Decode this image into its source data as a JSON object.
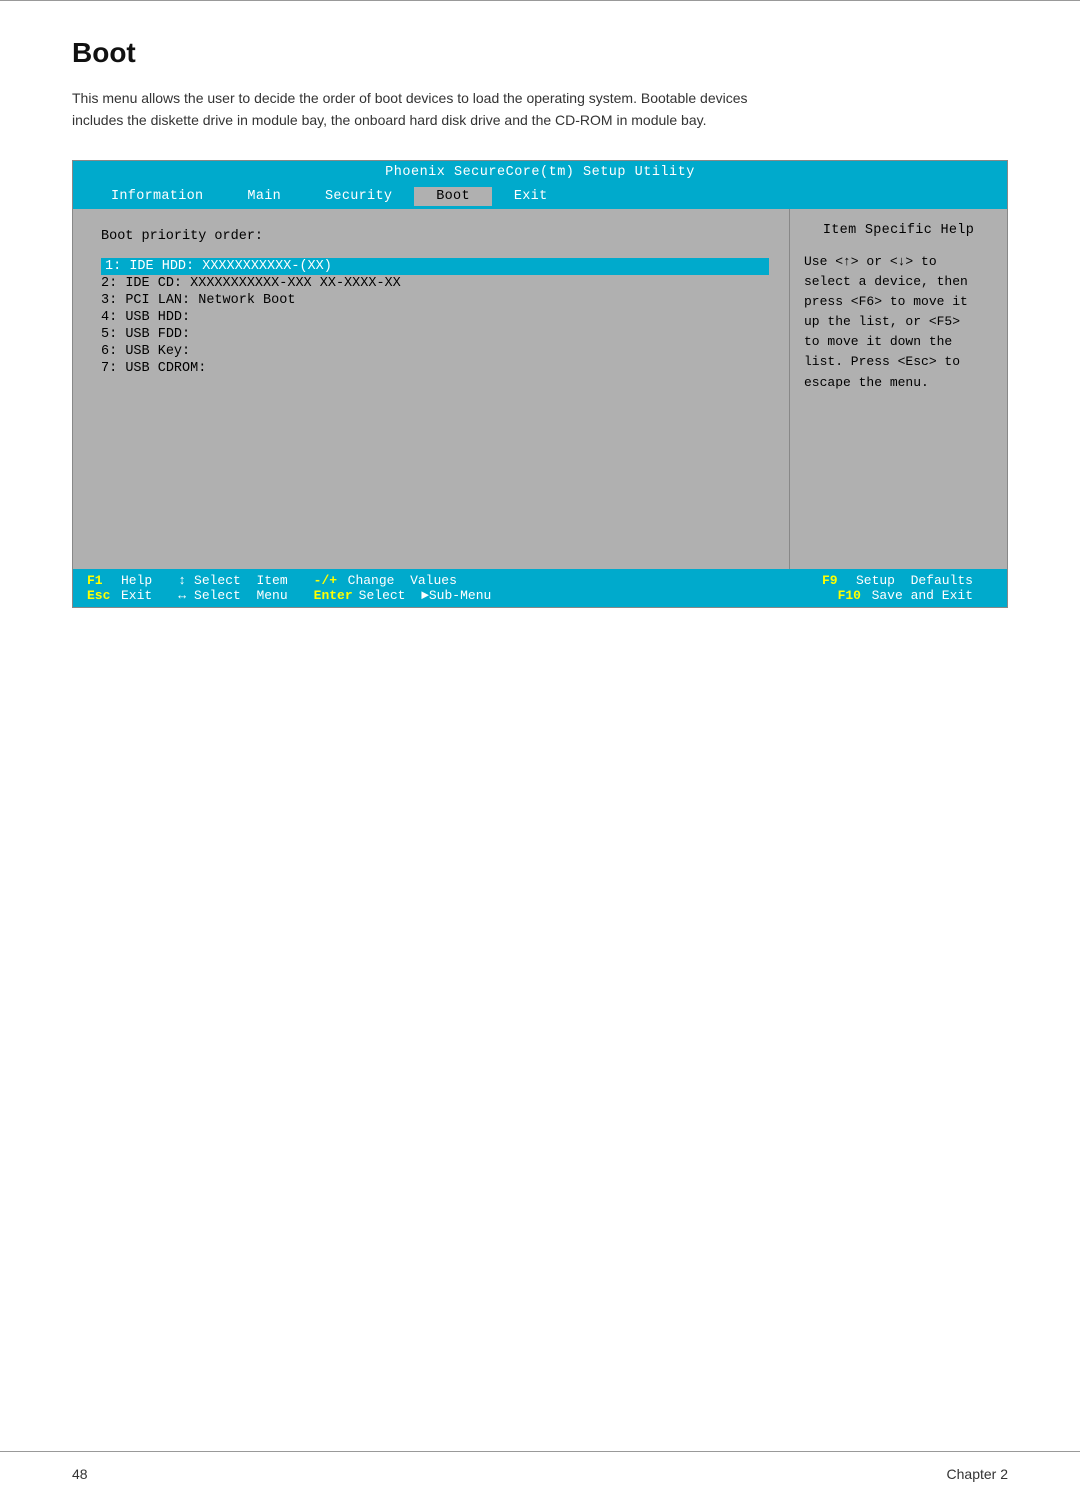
{
  "top_rule": true,
  "page": {
    "title": "Boot",
    "description_line1": "This menu allows the user to decide the order of boot devices to load the operating system. Bootable devices",
    "description_line2": "includes the diskette drive in module bay, the onboard hard disk drive and the CD-ROM in module bay."
  },
  "bios": {
    "title": "Phoenix SecureCore(tm) Setup Utility",
    "nav_items": [
      {
        "label": "Information",
        "active": false
      },
      {
        "label": "Main",
        "active": false
      },
      {
        "label": "Security",
        "active": false
      },
      {
        "label": "Boot",
        "active": true
      },
      {
        "label": "Exit",
        "active": false
      }
    ],
    "left_panel": {
      "section_title": "Boot priority order:",
      "boot_items": [
        {
          "index": "1:",
          "label": "IDE HDD: XXXXXXXXXXX-(XX)",
          "highlighted": true
        },
        {
          "index": "2:",
          "label": "IDE CD: XXXXXXXXXXX-XXX XX-XXXX-XX",
          "highlighted": false
        },
        {
          "index": "3:",
          "label": "PCI LAN: Network Boot",
          "highlighted": false
        },
        {
          "index": "4:",
          "label": "USB HDD:",
          "highlighted": false
        },
        {
          "index": "5:",
          "label": "USB FDD:",
          "highlighted": false
        },
        {
          "index": "6:",
          "label": "USB Key:",
          "highlighted": false
        },
        {
          "index": "7:",
          "label": "USB CDROM:",
          "highlighted": false
        }
      ]
    },
    "right_panel": {
      "help_title": "Item Specific Help",
      "help_text": "Use <↑> or <↓> to select a device, then press <F6> to move it up the list, or <F5> to move it down the list. Press <Esc> to escape the menu."
    },
    "footer_rows": [
      [
        {
          "type": "key",
          "text": "F1"
        },
        {
          "type": "desc",
          "text": "Help"
        },
        {
          "type": "icon",
          "text": "↕"
        },
        {
          "type": "desc",
          "text": "Select  Item"
        },
        {
          "type": "key",
          "text": "-/+"
        },
        {
          "type": "desc",
          "text": "Change  Values"
        },
        {
          "type": "key",
          "text": "F9"
        },
        {
          "type": "desc",
          "text": "Setup  Defaults"
        }
      ],
      [
        {
          "type": "key",
          "text": "Esc"
        },
        {
          "type": "desc",
          "text": "Exit"
        },
        {
          "type": "icon",
          "text": "↔"
        },
        {
          "type": "desc",
          "text": "Select  Menu"
        },
        {
          "type": "key",
          "text": "Enter"
        },
        {
          "type": "desc",
          "text": "Select  ►Sub-Menu"
        },
        {
          "type": "key",
          "text": "F10"
        },
        {
          "type": "desc",
          "text": "Save and Exit"
        }
      ]
    ]
  },
  "footer": {
    "page_number": "48",
    "chapter": "Chapter 2"
  }
}
